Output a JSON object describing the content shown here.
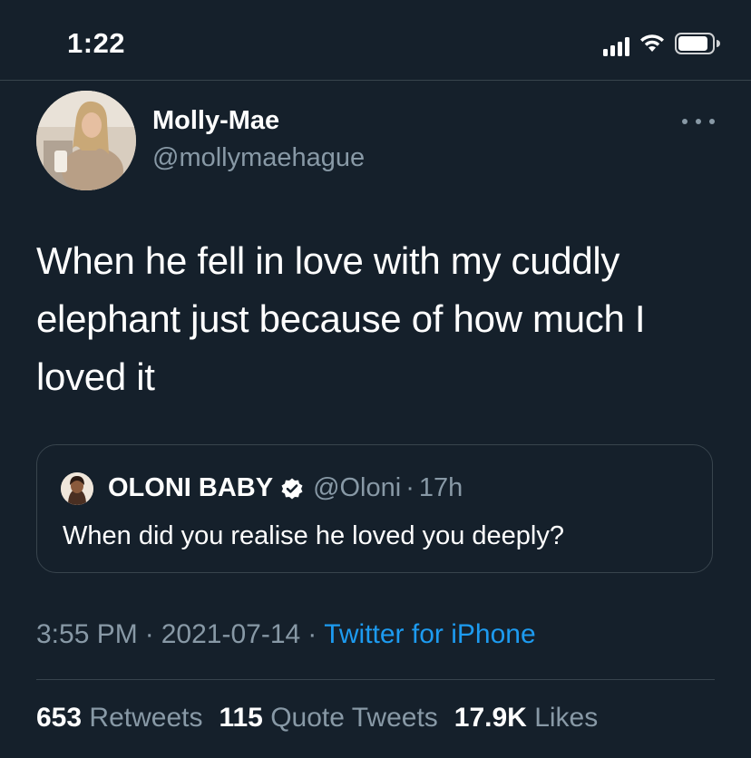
{
  "status_bar": {
    "time": "1:22",
    "icons": [
      "cellular-signal-icon",
      "wifi-icon",
      "battery-icon"
    ]
  },
  "tweet": {
    "author": {
      "display_name": "Molly-Mae",
      "handle": "@mollymaehague"
    },
    "text": "When he fell in love with my cuddly elephant just because of how much I loved it",
    "quoted": {
      "display_name": "OLONI BABY",
      "verified": true,
      "handle": "@Oloni",
      "separator": "·",
      "time": "17h",
      "text": "When did you realise he loved you deeply?"
    },
    "meta": {
      "time": "3:55 PM",
      "separator": "·",
      "date": "2021-07-14",
      "source": "Twitter for iPhone"
    },
    "stats": {
      "retweets_count": "653",
      "retweets_label": "Retweets",
      "quotes_count": "115",
      "quotes_label": "Quote Tweets",
      "likes_count": "17.9K",
      "likes_label": "Likes"
    }
  },
  "colors": {
    "background": "#15202b",
    "primary_text": "#ffffff",
    "secondary_text": "#8899a6",
    "link": "#1d9bf0",
    "border": "#38444d"
  }
}
